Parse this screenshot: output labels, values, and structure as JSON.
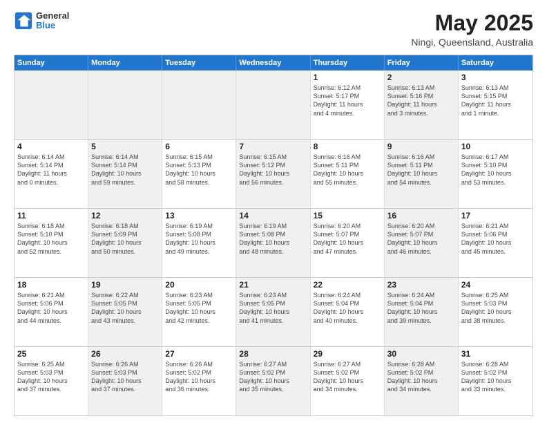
{
  "header": {
    "logo_general": "General",
    "logo_blue": "Blue",
    "month_year": "May 2025",
    "location": "Ningi, Queensland, Australia"
  },
  "days_of_week": [
    "Sunday",
    "Monday",
    "Tuesday",
    "Wednesday",
    "Thursday",
    "Friday",
    "Saturday"
  ],
  "weeks": [
    [
      {
        "day": "",
        "text": "",
        "shaded": true
      },
      {
        "day": "",
        "text": "",
        "shaded": true
      },
      {
        "day": "",
        "text": "",
        "shaded": true
      },
      {
        "day": "",
        "text": "",
        "shaded": true
      },
      {
        "day": "1",
        "text": "Sunrise: 6:12 AM\nSunset: 5:17 PM\nDaylight: 11 hours\nand 4 minutes.",
        "shaded": false
      },
      {
        "day": "2",
        "text": "Sunrise: 6:13 AM\nSunset: 5:16 PM\nDaylight: 11 hours\nand 3 minutes.",
        "shaded": true
      },
      {
        "day": "3",
        "text": "Sunrise: 6:13 AM\nSunset: 5:15 PM\nDaylight: 11 hours\nand 1 minute.",
        "shaded": false
      }
    ],
    [
      {
        "day": "4",
        "text": "Sunrise: 6:14 AM\nSunset: 5:14 PM\nDaylight: 11 hours\nand 0 minutes.",
        "shaded": false
      },
      {
        "day": "5",
        "text": "Sunrise: 6:14 AM\nSunset: 5:14 PM\nDaylight: 10 hours\nand 59 minutes.",
        "shaded": true
      },
      {
        "day": "6",
        "text": "Sunrise: 6:15 AM\nSunset: 5:13 PM\nDaylight: 10 hours\nand 58 minutes.",
        "shaded": false
      },
      {
        "day": "7",
        "text": "Sunrise: 6:15 AM\nSunset: 5:12 PM\nDaylight: 10 hours\nand 56 minutes.",
        "shaded": true
      },
      {
        "day": "8",
        "text": "Sunrise: 6:16 AM\nSunset: 5:11 PM\nDaylight: 10 hours\nand 55 minutes.",
        "shaded": false
      },
      {
        "day": "9",
        "text": "Sunrise: 6:16 AM\nSunset: 5:11 PM\nDaylight: 10 hours\nand 54 minutes.",
        "shaded": true
      },
      {
        "day": "10",
        "text": "Sunrise: 6:17 AM\nSunset: 5:10 PM\nDaylight: 10 hours\nand 53 minutes.",
        "shaded": false
      }
    ],
    [
      {
        "day": "11",
        "text": "Sunrise: 6:18 AM\nSunset: 5:10 PM\nDaylight: 10 hours\nand 52 minutes.",
        "shaded": false
      },
      {
        "day": "12",
        "text": "Sunrise: 6:18 AM\nSunset: 5:09 PM\nDaylight: 10 hours\nand 50 minutes.",
        "shaded": true
      },
      {
        "day": "13",
        "text": "Sunrise: 6:19 AM\nSunset: 5:08 PM\nDaylight: 10 hours\nand 49 minutes.",
        "shaded": false
      },
      {
        "day": "14",
        "text": "Sunrise: 6:19 AM\nSunset: 5:08 PM\nDaylight: 10 hours\nand 48 minutes.",
        "shaded": true
      },
      {
        "day": "15",
        "text": "Sunrise: 6:20 AM\nSunset: 5:07 PM\nDaylight: 10 hours\nand 47 minutes.",
        "shaded": false
      },
      {
        "day": "16",
        "text": "Sunrise: 6:20 AM\nSunset: 5:07 PM\nDaylight: 10 hours\nand 46 minutes.",
        "shaded": true
      },
      {
        "day": "17",
        "text": "Sunrise: 6:21 AM\nSunset: 5:06 PM\nDaylight: 10 hours\nand 45 minutes.",
        "shaded": false
      }
    ],
    [
      {
        "day": "18",
        "text": "Sunrise: 6:21 AM\nSunset: 5:06 PM\nDaylight: 10 hours\nand 44 minutes.",
        "shaded": false
      },
      {
        "day": "19",
        "text": "Sunrise: 6:22 AM\nSunset: 5:05 PM\nDaylight: 10 hours\nand 43 minutes.",
        "shaded": true
      },
      {
        "day": "20",
        "text": "Sunrise: 6:23 AM\nSunset: 5:05 PM\nDaylight: 10 hours\nand 42 minutes.",
        "shaded": false
      },
      {
        "day": "21",
        "text": "Sunrise: 6:23 AM\nSunset: 5:05 PM\nDaylight: 10 hours\nand 41 minutes.",
        "shaded": true
      },
      {
        "day": "22",
        "text": "Sunrise: 6:24 AM\nSunset: 5:04 PM\nDaylight: 10 hours\nand 40 minutes.",
        "shaded": false
      },
      {
        "day": "23",
        "text": "Sunrise: 6:24 AM\nSunset: 5:04 PM\nDaylight: 10 hours\nand 39 minutes.",
        "shaded": true
      },
      {
        "day": "24",
        "text": "Sunrise: 6:25 AM\nSunset: 5:03 PM\nDaylight: 10 hours\nand 38 minutes.",
        "shaded": false
      }
    ],
    [
      {
        "day": "25",
        "text": "Sunrise: 6:25 AM\nSunset: 5:03 PM\nDaylight: 10 hours\nand 37 minutes.",
        "shaded": false
      },
      {
        "day": "26",
        "text": "Sunrise: 6:26 AM\nSunset: 5:03 PM\nDaylight: 10 hours\nand 37 minutes.",
        "shaded": true
      },
      {
        "day": "27",
        "text": "Sunrise: 6:26 AM\nSunset: 5:02 PM\nDaylight: 10 hours\nand 36 minutes.",
        "shaded": false
      },
      {
        "day": "28",
        "text": "Sunrise: 6:27 AM\nSunset: 5:02 PM\nDaylight: 10 hours\nand 35 minutes.",
        "shaded": true
      },
      {
        "day": "29",
        "text": "Sunrise: 6:27 AM\nSunset: 5:02 PM\nDaylight: 10 hours\nand 34 minutes.",
        "shaded": false
      },
      {
        "day": "30",
        "text": "Sunrise: 6:28 AM\nSunset: 5:02 PM\nDaylight: 10 hours\nand 34 minutes.",
        "shaded": true
      },
      {
        "day": "31",
        "text": "Sunrise: 6:28 AM\nSunset: 5:02 PM\nDaylight: 10 hours\nand 33 minutes.",
        "shaded": false
      }
    ]
  ]
}
